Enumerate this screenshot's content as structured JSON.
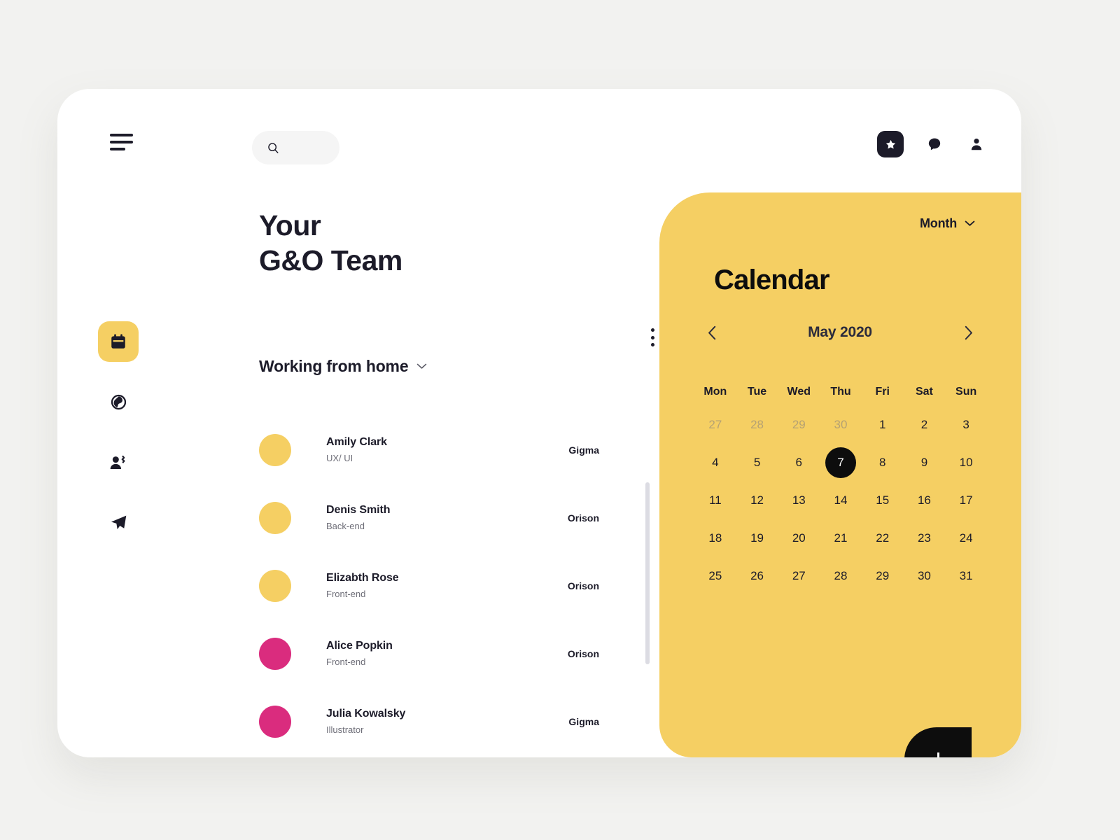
{
  "topbar": {
    "menu_icon": "hamburger-icon",
    "search": {
      "icon": "search-icon",
      "placeholder": "",
      "value": ""
    },
    "actions": [
      {
        "name": "star-badge",
        "icon": "star-icon"
      },
      {
        "name": "chat",
        "icon": "chat-bubble-icon"
      },
      {
        "name": "profile",
        "icon": "person-icon"
      }
    ]
  },
  "sidebar": {
    "items": [
      {
        "name": "calendar",
        "icon": "calendar-icon",
        "active": true
      },
      {
        "name": "globe",
        "icon": "globe-icon",
        "active": false
      },
      {
        "name": "team",
        "icon": "people-icon",
        "active": false
      },
      {
        "name": "send",
        "icon": "paper-plane-icon",
        "active": false
      }
    ]
  },
  "team": {
    "title_line1": "Your",
    "title_line2": "G&O Team",
    "more_icon": "kebab-menu-icon",
    "filter_label": "Working from home",
    "filter_icon": "chevron-down-icon",
    "members": [
      {
        "name": "Amily Clark",
        "role": "UX/ UI",
        "project": "Gigma",
        "color": "#f5cf63"
      },
      {
        "name": "Denis Smith",
        "role": "Back-end",
        "project": "Orison",
        "color": "#f5cf63"
      },
      {
        "name": "Elizabth Rose",
        "role": "Front-end",
        "project": "Orison",
        "color": "#f5cf63"
      },
      {
        "name": "Alice Popkin",
        "role": "Front-end",
        "project": "Orison",
        "color": "#da2c7e"
      },
      {
        "name": "Julia Kowalsky",
        "role": "Illustrator",
        "project": "Gigma",
        "color": "#da2c7e"
      }
    ]
  },
  "calendar": {
    "view_label": "Month",
    "view_icon": "chevron-down-icon",
    "title": "Calendar",
    "month_label": "May 2020",
    "prev_icon": "chevron-left-icon",
    "next_icon": "chevron-right-icon",
    "day_headers": [
      "Mon",
      "Tue",
      "Wed",
      "Thu",
      "Fri",
      "Sat",
      "Sun"
    ],
    "weeks": [
      [
        {
          "d": "27",
          "muted": true
        },
        {
          "d": "28",
          "muted": true
        },
        {
          "d": "29",
          "muted": true
        },
        {
          "d": "30",
          "muted": true
        },
        {
          "d": "1"
        },
        {
          "d": "2"
        },
        {
          "d": "3"
        }
      ],
      [
        {
          "d": "4"
        },
        {
          "d": "5"
        },
        {
          "d": "6"
        },
        {
          "d": "7",
          "selected": true
        },
        {
          "d": "8"
        },
        {
          "d": "9"
        },
        {
          "d": "10"
        }
      ],
      [
        {
          "d": "11"
        },
        {
          "d": "12"
        },
        {
          "d": "13"
        },
        {
          "d": "14"
        },
        {
          "d": "15"
        },
        {
          "d": "16"
        },
        {
          "d": "17"
        }
      ],
      [
        {
          "d": "18"
        },
        {
          "d": "19"
        },
        {
          "d": "20"
        },
        {
          "d": "21"
        },
        {
          "d": "22"
        },
        {
          "d": "23"
        },
        {
          "d": "24"
        }
      ],
      [
        {
          "d": "25"
        },
        {
          "d": "26"
        },
        {
          "d": "27"
        },
        {
          "d": "28"
        },
        {
          "d": "29"
        },
        {
          "d": "30"
        },
        {
          "d": "31"
        }
      ]
    ],
    "add_button_icon": "plus-icon"
  },
  "colors": {
    "accent_yellow": "#f5cf63",
    "accent_pink": "#da2c7e",
    "ink": "#1c1b29",
    "page_bg": "#f2f2f0",
    "card_bg": "#ffffff"
  }
}
